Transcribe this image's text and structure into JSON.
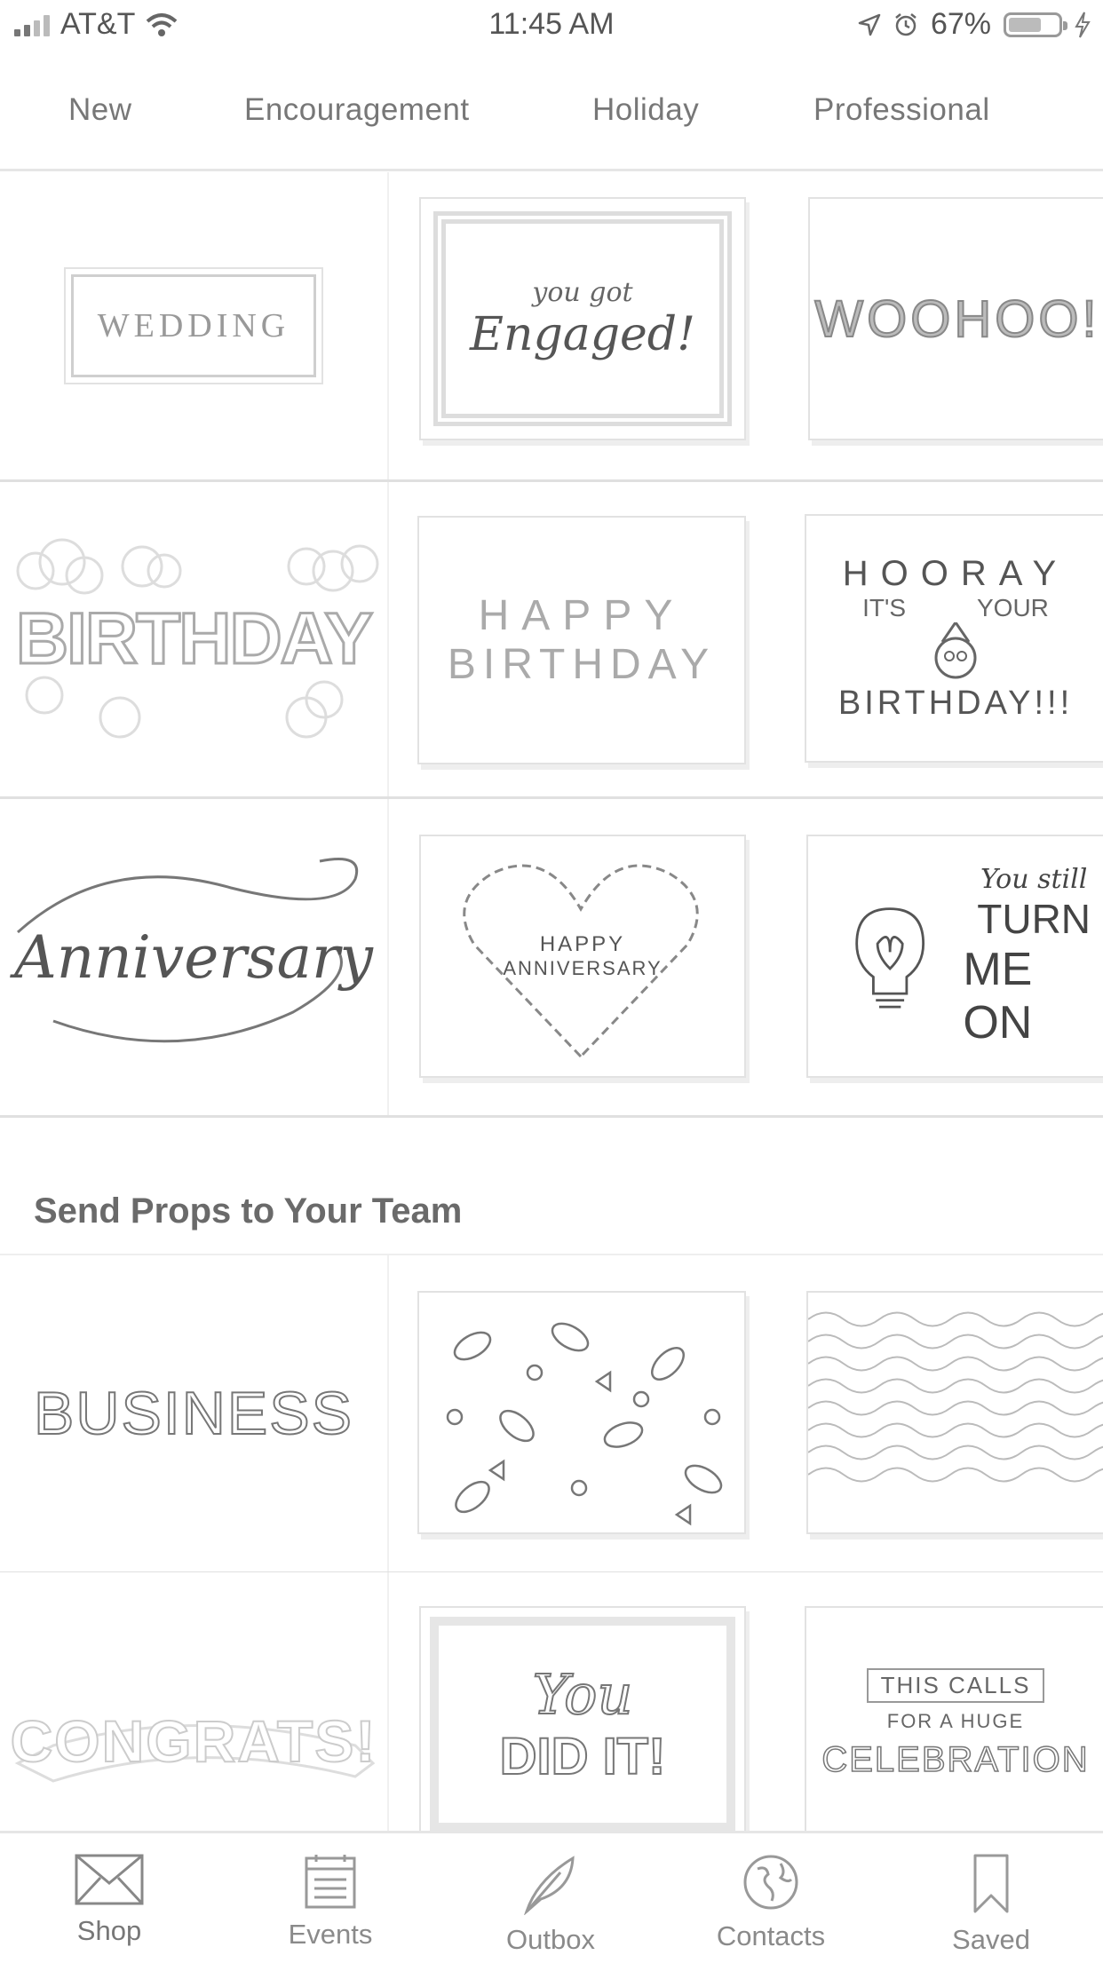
{
  "status_bar": {
    "carrier": "AT&T",
    "time": "11:45 AM",
    "battery": "67%",
    "battery_level": 0.67,
    "icons": [
      "signal-icon",
      "wifi-icon",
      "location-icon",
      "alarm-icon",
      "battery-icon",
      "charging-icon"
    ]
  },
  "tabs": [
    {
      "label": "New"
    },
    {
      "label": "Encouragement"
    },
    {
      "label": "Holiday"
    },
    {
      "label": "Professional"
    }
  ],
  "rows": [
    {
      "category": "WEDDING",
      "cards": [
        "You Got Engaged!",
        "WOOHOO!"
      ]
    },
    {
      "category": "BIRTHDAY",
      "cards": [
        "HAPPY BIRTHDAY",
        "HOORAY IT'S YOUR BIRTHDAY!!!"
      ]
    },
    {
      "category": "Anniversary",
      "cards": [
        "HAPPY ANNIVERSARY",
        "You still TURN ME ON"
      ]
    }
  ],
  "section": {
    "title": "Send Props to Your Team"
  },
  "team_rows": [
    {
      "category": "BUSINESS",
      "cards": [
        "",
        ""
      ]
    },
    {
      "category": "CONGRATS!",
      "cards": [
        "You DID IT!",
        "THIS CALLS FOR A HUGE CELEBRATION"
      ]
    }
  ],
  "card_text": {
    "engaged_1": "you got",
    "engaged_2": "Engaged!",
    "woohoo": "WOOHOO!",
    "hb_1": "HAPPY",
    "hb_2": "BIRTHDAY",
    "hooray_1": "HOORAY",
    "hooray_2": "IT'S",
    "hooray_3": "YOUR",
    "hooray_4": "BIRTHDAY!!!",
    "ha_1": "HAPPY",
    "ha_2": "ANNIVERSARY",
    "turn_1": "You still",
    "turn_2": "TURN",
    "turn_3": "ME ON",
    "did_1": "You",
    "did_2": "DID IT!",
    "celeb_1": "THIS CALLS",
    "celeb_2": "FOR A HUGE",
    "celeb_3": "CELEBRATION"
  },
  "bottom_nav": [
    {
      "label": "Shop",
      "icon": "envelope-icon",
      "active": true
    },
    {
      "label": "Events",
      "icon": "calendar-icon",
      "active": false
    },
    {
      "label": "Outbox",
      "icon": "feather-icon",
      "active": false
    },
    {
      "label": "Contacts",
      "icon": "globe-icon",
      "active": false
    },
    {
      "label": "Saved",
      "icon": "bookmark-icon",
      "active": false
    }
  ]
}
